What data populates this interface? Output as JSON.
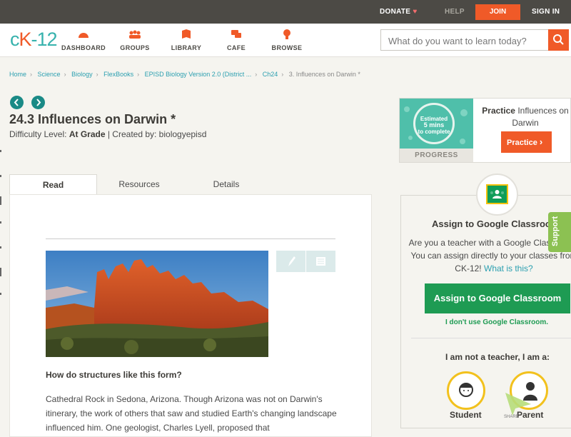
{
  "topbar": {
    "donate": "DONATE",
    "help": "HELP",
    "join": "JOIN",
    "signin": "SIGN IN",
    "accent": "#f05a28"
  },
  "header": {
    "logo": {
      "ck": "c",
      "k": "K",
      "dash": "-",
      "num": "12"
    },
    "nav": [
      {
        "label": "DASHBOARD",
        "icon": "dashboard-icon"
      },
      {
        "label": "GROUPS",
        "icon": "groups-icon"
      },
      {
        "label": "LIBRARY",
        "icon": "library-icon"
      },
      {
        "label": "CAFE",
        "icon": "cafe-icon"
      },
      {
        "label": "BROWSE",
        "icon": "browse-icon"
      }
    ],
    "search_placeholder": "What do you want to learn today?"
  },
  "breadcrumb": [
    "Home",
    "Science",
    "Biology",
    "FlexBooks",
    "EPISD Biology Version 2.0 (District ...",
    "Ch24",
    "3. Influences on Darwin *"
  ],
  "lesson": {
    "title": "24.3 Influences on Darwin *",
    "difficulty_label": "Difficulty Level:",
    "difficulty": "At Grade",
    "created_by": "| Created by: biologyepisd"
  },
  "tabs": [
    "Read",
    "Resources",
    "Details"
  ],
  "content": {
    "question": "How do structures like this form?",
    "body": "Cathedral Rock in Sedona, Arizona. Though Arizona was not on Darwin's itinerary, the work of others that saw and studied Earth's changing landscape influenced him. One geologist, Charles Lyell, proposed that"
  },
  "practice": {
    "circle_top": "Estimated",
    "circle_mins": "5 mins",
    "circle_bottom": "to complete",
    "progress": "PROGRESS",
    "heading_bold": "Practice",
    "heading_rest": " Influences on Darwin",
    "button": "Practice"
  },
  "google": {
    "title": "Assign to Google Classroom",
    "text": "Are you a teacher with a Google Classroom? You can assign directly to your classes from CK-12!",
    "link": "What is this?",
    "button": "Assign to Google Classroom",
    "no": "I don't use Google Classroom.",
    "not_teacher": "I am not a teacher, I am a:",
    "roles": [
      "Student",
      "Parent"
    ],
    "brand_green": "#1e9b53"
  },
  "support": "Support",
  "share": "SHARE"
}
